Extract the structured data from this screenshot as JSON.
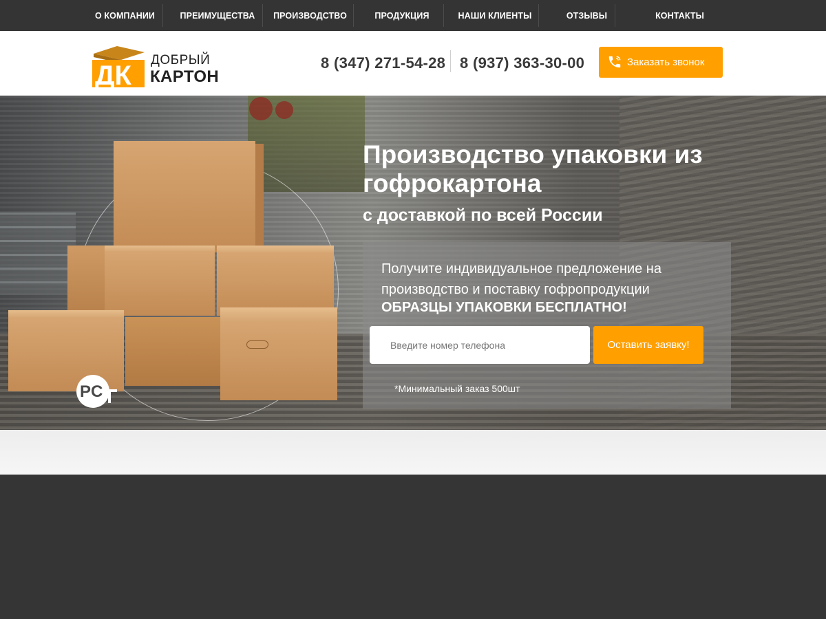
{
  "nav": {
    "items": [
      "О КОМПАНИИ",
      "ПРЕИМУЩЕСТВА",
      "ПРОИЗВОДСТВО",
      "ПРОДУКЦИЯ",
      "НАШИ КЛИЕНТЫ",
      "ОТЗЫВЫ",
      "КОНТАКТЫ"
    ]
  },
  "header": {
    "logo_letters": "ДК",
    "logo_line1": "ДОБРЫЙ",
    "logo_line2": "КАРТОН",
    "phone1": "8 (347) 271-54-28",
    "phone2": "8 (937) 363-30-00",
    "call_button": "Заказать звонок",
    "call_icon": "phone-icon"
  },
  "hero": {
    "title": "Производство упаковки из гофрокартона",
    "subtitle": "с доставкой по всей России",
    "offer_text": "Получите индивидуальное предложение на производство и поставку гофропродукции",
    "offer_strong": "ОБРАЗЦЫ УПАКОВКИ БЕСПЛАТНО!",
    "phone_placeholder": "Введите номер телефона",
    "submit_button": "Оставить заявку!",
    "min_order": "*Минимальный заказ 500шт",
    "gost_icon": "gost-certification-icon"
  },
  "colors": {
    "accent": "#ff9f00",
    "nav_bg": "#343434",
    "footer_bg": "#353535"
  }
}
